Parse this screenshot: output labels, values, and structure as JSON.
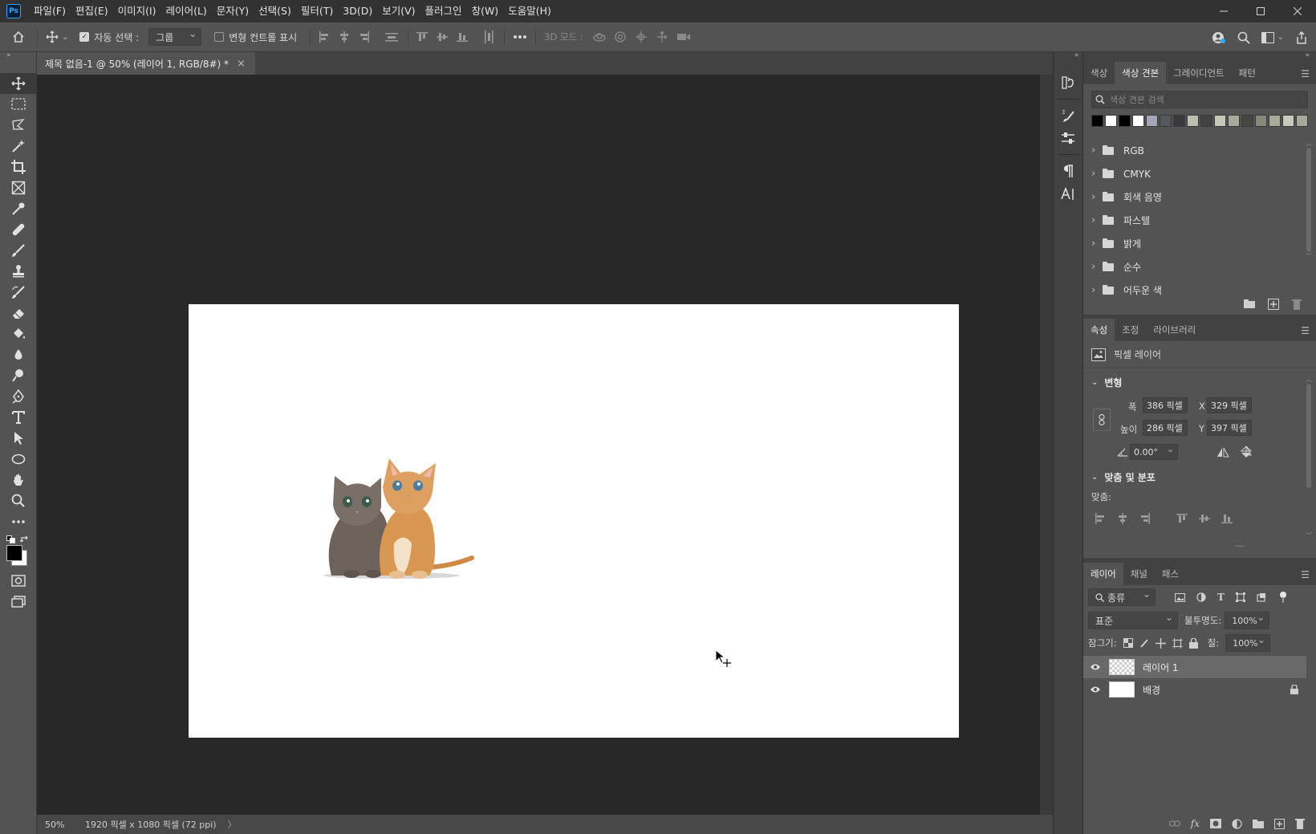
{
  "menu": {
    "items": [
      "파일(F)",
      "편집(E)",
      "이미지(I)",
      "레이어(L)",
      "문자(Y)",
      "선택(S)",
      "필터(T)",
      "3D(D)",
      "보기(V)",
      "플러그인",
      "창(W)",
      "도움말(H)"
    ]
  },
  "options_bar": {
    "auto_select_label": "자동 선택 :",
    "auto_select_value": "그룹",
    "transform_controls_label": "변형 컨트롤 표시",
    "mode_3d_label": "3D 모드 :"
  },
  "document": {
    "tab_title": "제목 없음-1 @ 50% (레이어 1, RGB/8#) *",
    "close": "×"
  },
  "status": {
    "zoom": "50%",
    "doc_info": "1920 픽셀 x 1080 픽셀 (72 ppi)",
    "arrow": "〉"
  },
  "swatches_panel": {
    "tabs": [
      "색상",
      "색상 견본",
      "그레이디언트",
      "패턴"
    ],
    "active_tab": 1,
    "search_placeholder": "색상 견본 검색",
    "recent_colors": [
      "#000000",
      "#ffffff",
      "#000000",
      "#ffffff",
      "#a6a6b8",
      "#55595e",
      "#3a3a3a",
      "#bdbdb0",
      "#424242",
      "#c6c6b9",
      "#a9a99c",
      "#44463f",
      "#888879",
      "#a9ab9a",
      "#c8c9bb",
      "#a6a89a"
    ],
    "folders": [
      "RGB",
      "CMYK",
      "회색 음영",
      "파스텔",
      "밝게",
      "순수",
      "어두운 색"
    ]
  },
  "properties_panel": {
    "tabs": [
      "속성",
      "조정",
      "라이브러리"
    ],
    "active_tab": 0,
    "layer_type": "픽셀 레이어",
    "transform_section": "변형",
    "width_label": "폭",
    "width_value": "386 픽셀",
    "height_label": "높이",
    "height_value": "286 픽셀",
    "x_label": "X",
    "x_value": "329 픽셀",
    "y_label": "Y",
    "y_value": "397 픽셀",
    "angle_value": "0.00°",
    "align_section": "맞춤 및 분포",
    "align_label": "맞춤:",
    "more": "..."
  },
  "layers_panel": {
    "tabs": [
      "레이어",
      "채널",
      "패스"
    ],
    "active_tab": 0,
    "filter_label": "종류",
    "blend_mode": "표준",
    "opacity_label": "불투명도:",
    "opacity_value": "100%",
    "lock_label": "잠그기:",
    "fill_label": "칠:",
    "fill_value": "100%",
    "layers": [
      {
        "name": "레이어 1",
        "selected": true,
        "locked": false,
        "transparent": true
      },
      {
        "name": "배경",
        "selected": false,
        "locked": true,
        "transparent": false
      }
    ]
  },
  "colors": {
    "menubar_bg": "#323232",
    "ui_bg": "#535353",
    "dark_bg": "#282828",
    "accent": "#31a8ff",
    "cat_left": "#6d625a",
    "cat_right": "#d89852"
  }
}
